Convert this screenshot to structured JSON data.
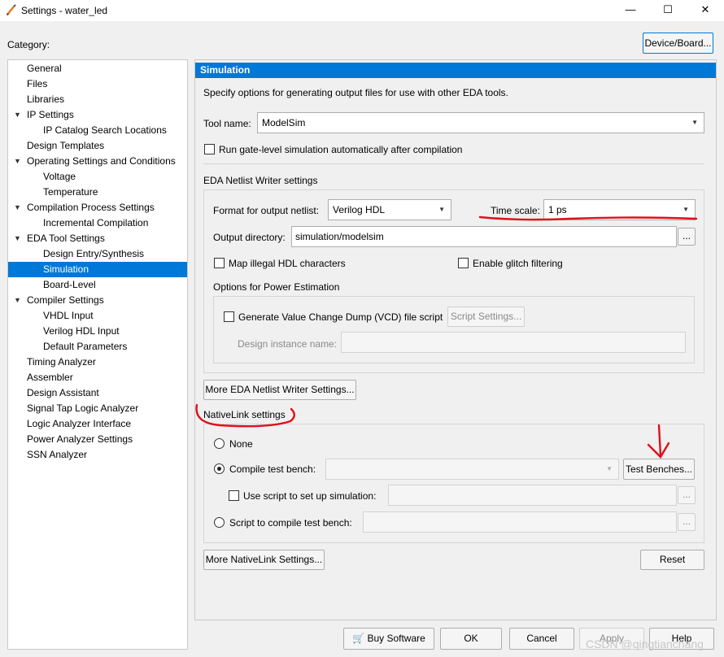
{
  "window": {
    "title": "Settings - water_led",
    "minimize": "—",
    "maximize": "☐",
    "close": "✕"
  },
  "category_label": "Category:",
  "device_board_button": "Device/Board...",
  "tree": [
    {
      "label": "General"
    },
    {
      "label": "Files"
    },
    {
      "label": "Libraries"
    },
    {
      "label": "IP Settings",
      "expand": "▼"
    },
    {
      "label": "IP Catalog Search Locations"
    },
    {
      "label": "Design Templates"
    },
    {
      "label": "Operating Settings and Conditions",
      "expand": "▼"
    },
    {
      "label": "Voltage"
    },
    {
      "label": "Temperature"
    },
    {
      "label": "Compilation Process Settings",
      "expand": "▼"
    },
    {
      "label": "Incremental Compilation"
    },
    {
      "label": "EDA Tool Settings",
      "expand": "▼"
    },
    {
      "label": "Design Entry/Synthesis"
    },
    {
      "label": "Simulation"
    },
    {
      "label": "Board-Level"
    },
    {
      "label": "Compiler Settings",
      "expand": "▼"
    },
    {
      "label": "VHDL Input"
    },
    {
      "label": "Verilog HDL Input"
    },
    {
      "label": "Default Parameters"
    },
    {
      "label": "Timing Analyzer"
    },
    {
      "label": "Assembler"
    },
    {
      "label": "Design Assistant"
    },
    {
      "label": "Signal Tap Logic Analyzer"
    },
    {
      "label": "Logic Analyzer Interface"
    },
    {
      "label": "Power Analyzer Settings"
    },
    {
      "label": "SSN Analyzer"
    }
  ],
  "simulation": {
    "header": "Simulation",
    "description": "Specify options for generating output files for use with other EDA tools.",
    "tool_name_label": "Tool name:",
    "tool_name_value": "ModelSim",
    "run_gate_level_label": "Run gate-level simulation automatically after compilation",
    "eda_section_title": "EDA Netlist Writer settings",
    "format_label": "Format for output netlist:",
    "format_value": "Verilog HDL",
    "time_scale_label": "Time scale:",
    "time_scale_value": "1 ps",
    "output_dir_label": "Output directory:",
    "output_dir_value": "simulation/modelsim",
    "browse": "...",
    "map_illegal_label": "Map illegal HDL characters",
    "glitch_label": "Enable glitch filtering",
    "power_title": "Options for Power Estimation",
    "vcd_label": "Generate Value Change Dump (VCD) file script",
    "script_settings_button": "Script Settings...",
    "design_instance_label": "Design instance name:",
    "more_eda_button": "More EDA Netlist Writer Settings...",
    "nativelink_title": "NativeLink settings",
    "none_label": "None",
    "compile_tb_label": "Compile test bench:",
    "test_benches_button": "Test Benches...",
    "use_script_label": "Use script to set up simulation:",
    "script_compile_label": "Script to compile test bench:",
    "more_nativelink_button": "More NativeLink Settings...",
    "reset_button": "Reset"
  },
  "footer": {
    "buy_software": "Buy Software",
    "ok": "OK",
    "cancel": "Cancel",
    "apply": "Apply",
    "help": "Help"
  },
  "watermark": "CSDN @qingtianchang",
  "colors": {
    "selection": "#0078d7",
    "annotation": "#e0101a"
  }
}
